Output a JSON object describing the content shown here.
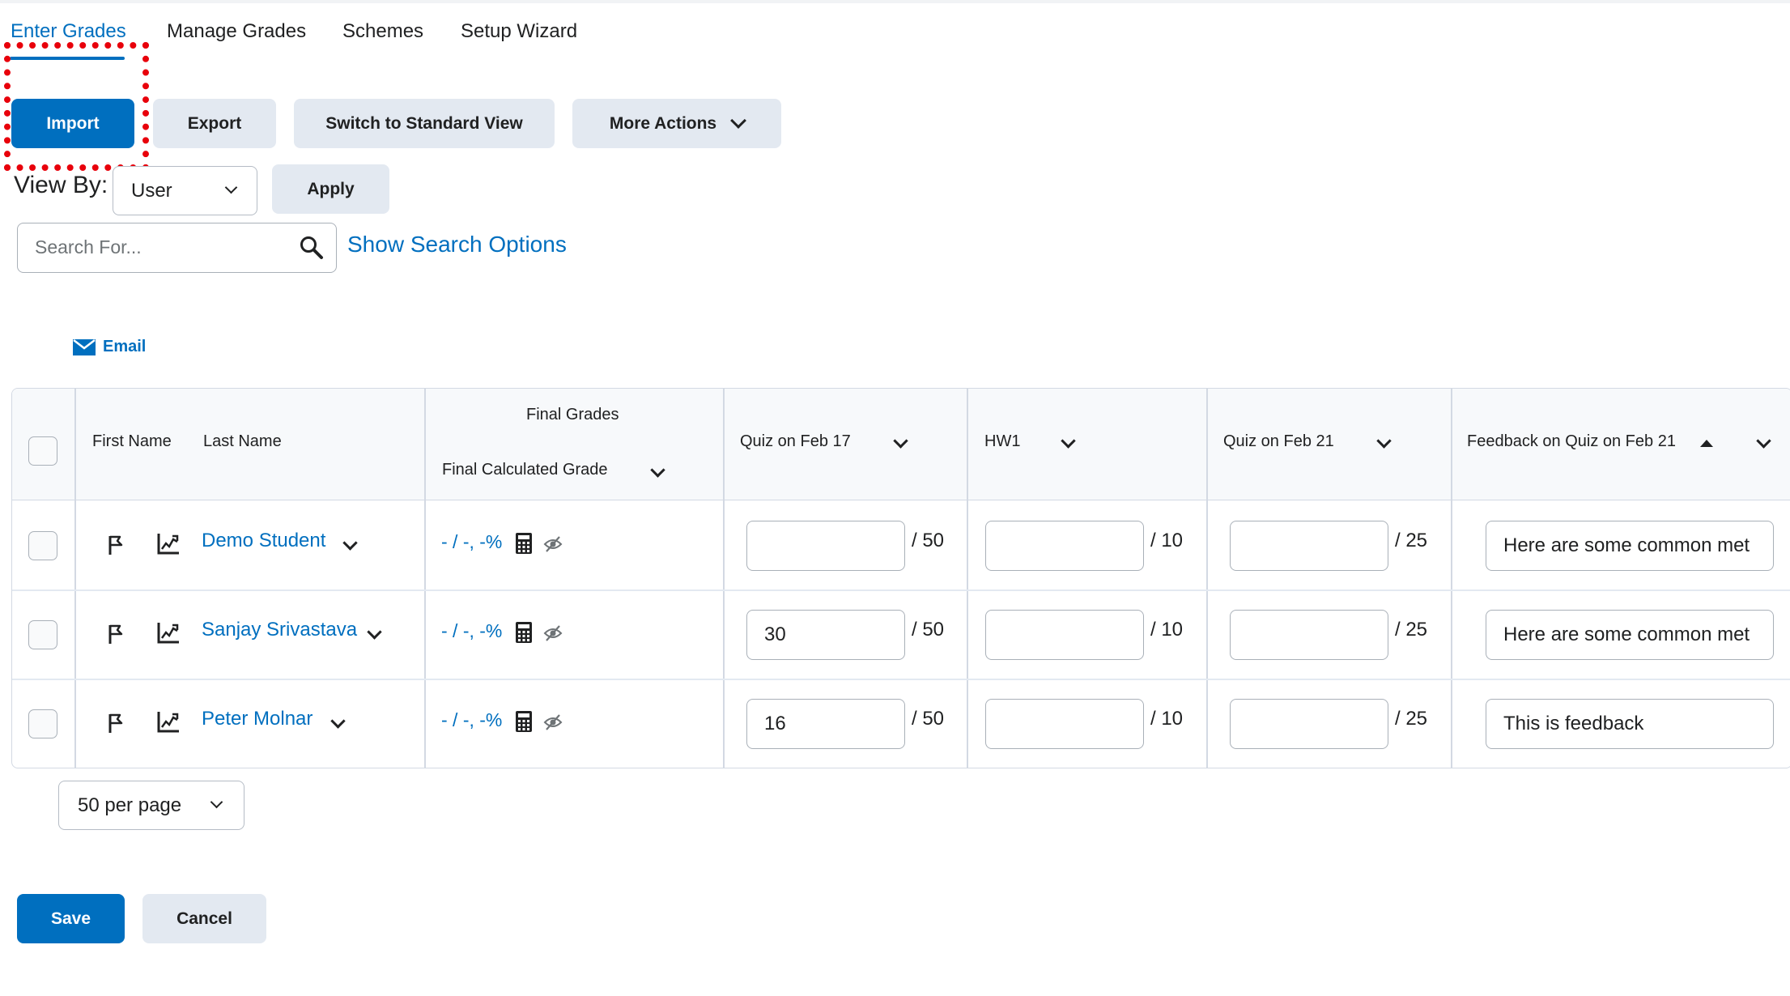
{
  "tabs": [
    {
      "label": "Enter Grades",
      "active": true
    },
    {
      "label": "Manage Grades",
      "active": false
    },
    {
      "label": "Schemes",
      "active": false
    },
    {
      "label": "Setup Wizard",
      "active": false
    }
  ],
  "toolbar": {
    "import_label": "Import",
    "export_label": "Export",
    "switch_view_label": "Switch to Standard View",
    "more_actions_label": "More Actions"
  },
  "view_by": {
    "label": "View By:",
    "selected": "User",
    "apply_label": "Apply"
  },
  "search": {
    "placeholder": "Search For...",
    "value": "",
    "show_options_label": "Show Search Options"
  },
  "email": {
    "label": "Email"
  },
  "table": {
    "headers": {
      "first_name": "First Name",
      "last_name": "Last Name",
      "final_grades": "Final Grades",
      "final_calculated_grade": "Final Calculated Grade",
      "quiz_feb17": "Quiz on Feb 17",
      "hw1": "HW1",
      "quiz_feb21": "Quiz on Feb 21",
      "feedback_feb21": "Feedback on Quiz on Feb 21"
    },
    "rows": [
      {
        "name": "Demo Student",
        "final_grade": "- / -, -%",
        "quiz_feb17": "",
        "quiz_feb17_max": "/ 50",
        "hw1": "",
        "hw1_max": "/ 10",
        "quiz_feb21": "",
        "quiz_feb21_max": "/ 25",
        "feedback": "Here are some common met"
      },
      {
        "name": "Sanjay Srivastava",
        "final_grade": "- / -, -%",
        "quiz_feb17": "30",
        "quiz_feb17_max": "/ 50",
        "hw1": "",
        "hw1_max": "/ 10",
        "quiz_feb21": "",
        "quiz_feb21_max": "/ 25",
        "feedback": "Here are some common met"
      },
      {
        "name": "Peter Molnar",
        "final_grade": "- / -, -%",
        "quiz_feb17": "16",
        "quiz_feb17_max": "/ 50",
        "hw1": "",
        "hw1_max": "/ 10",
        "quiz_feb21": "",
        "quiz_feb21_max": "/ 25",
        "feedback": "This is feedback"
      }
    ]
  },
  "pagination": {
    "per_page": "50 per page"
  },
  "footer": {
    "save_label": "Save",
    "cancel_label": "Cancel"
  },
  "colors": {
    "primary": "#006fbf",
    "secondary_button": "#e3e9f1",
    "highlight": "#e8000b"
  }
}
